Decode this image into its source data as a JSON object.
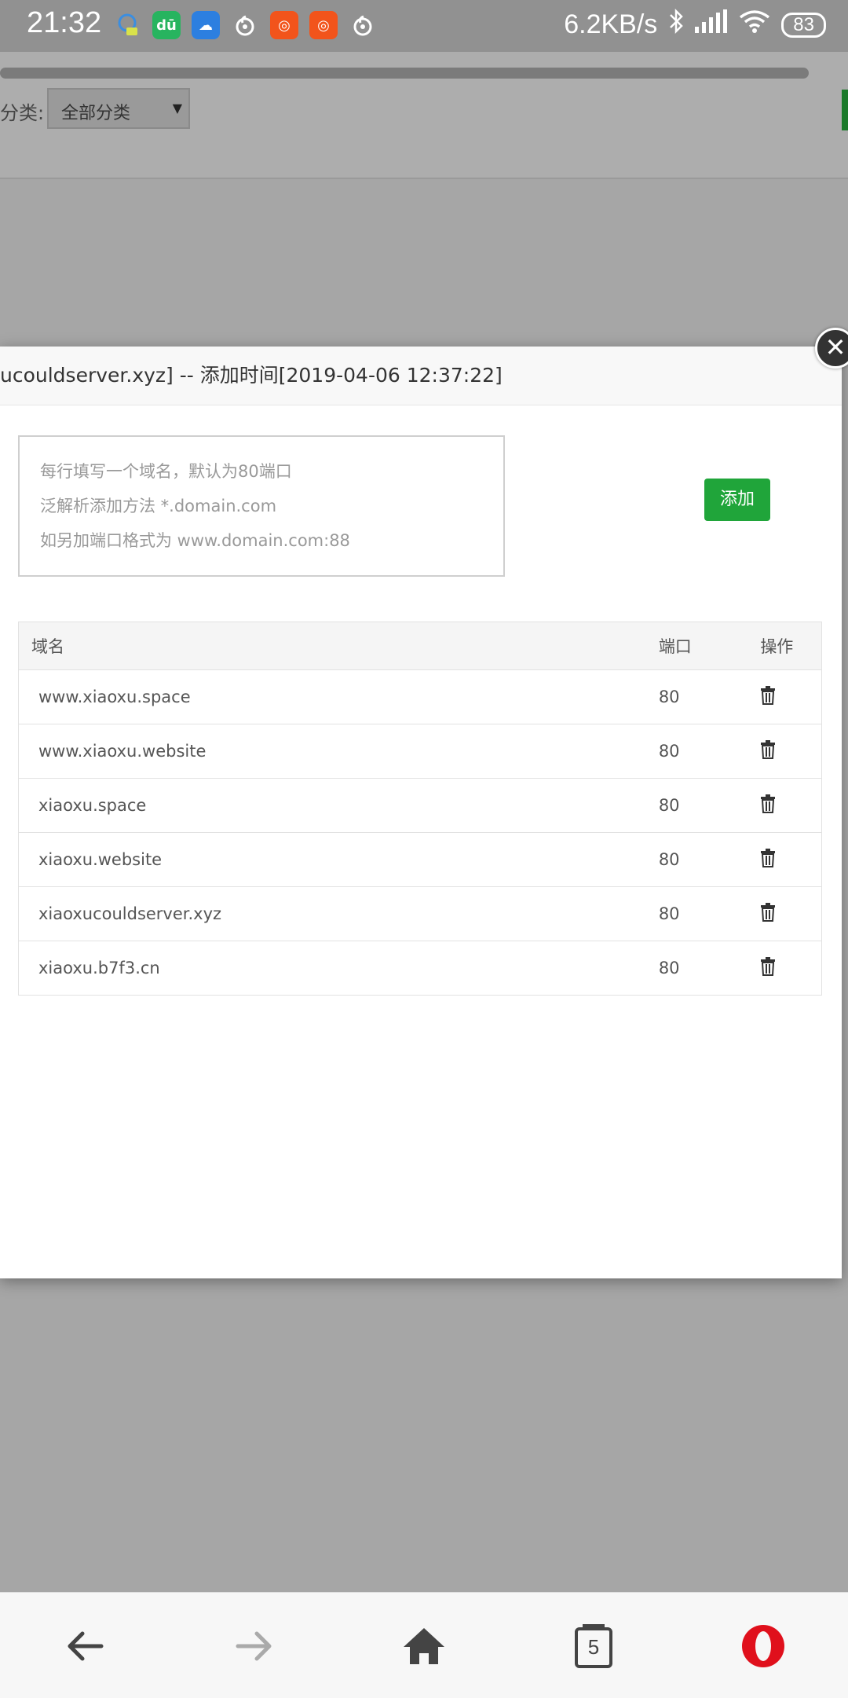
{
  "status": {
    "time": "21:32",
    "speed": "6.2KB/s",
    "battery": "83",
    "icons": [
      "qq-icon",
      "du-icon",
      "weather-icon",
      "netease-music-icon",
      "orange-app-icon",
      "orange-app-icon",
      "netease-music-icon"
    ]
  },
  "page": {
    "category_label": "分类:",
    "category_value": "全部分类"
  },
  "modal": {
    "title": "ucouldserver.xyz] -- 添加时间[2019-04-06 12:37:22]",
    "placeholder": "每行填写一个域名，默认为80端口\n泛解析添加方法 *.domain.com\n如另加端口格式为 www.domain.com:88",
    "add_label": "添加",
    "columns": [
      "域名",
      "端口",
      "操作"
    ],
    "rows": [
      {
        "domain": "www.xiaoxu.space",
        "port": "80"
      },
      {
        "domain": "www.xiaoxu.website",
        "port": "80"
      },
      {
        "domain": "xiaoxu.space",
        "port": "80"
      },
      {
        "domain": "xiaoxu.website",
        "port": "80"
      },
      {
        "domain": "xiaoxucouldserver.xyz",
        "port": "80"
      },
      {
        "domain": "xiaoxu.b7f3.cn",
        "port": "80"
      }
    ]
  },
  "browser": {
    "tab_count": "5"
  },
  "colors": {
    "accent": "#20a53a",
    "opera": "#e0101c"
  }
}
